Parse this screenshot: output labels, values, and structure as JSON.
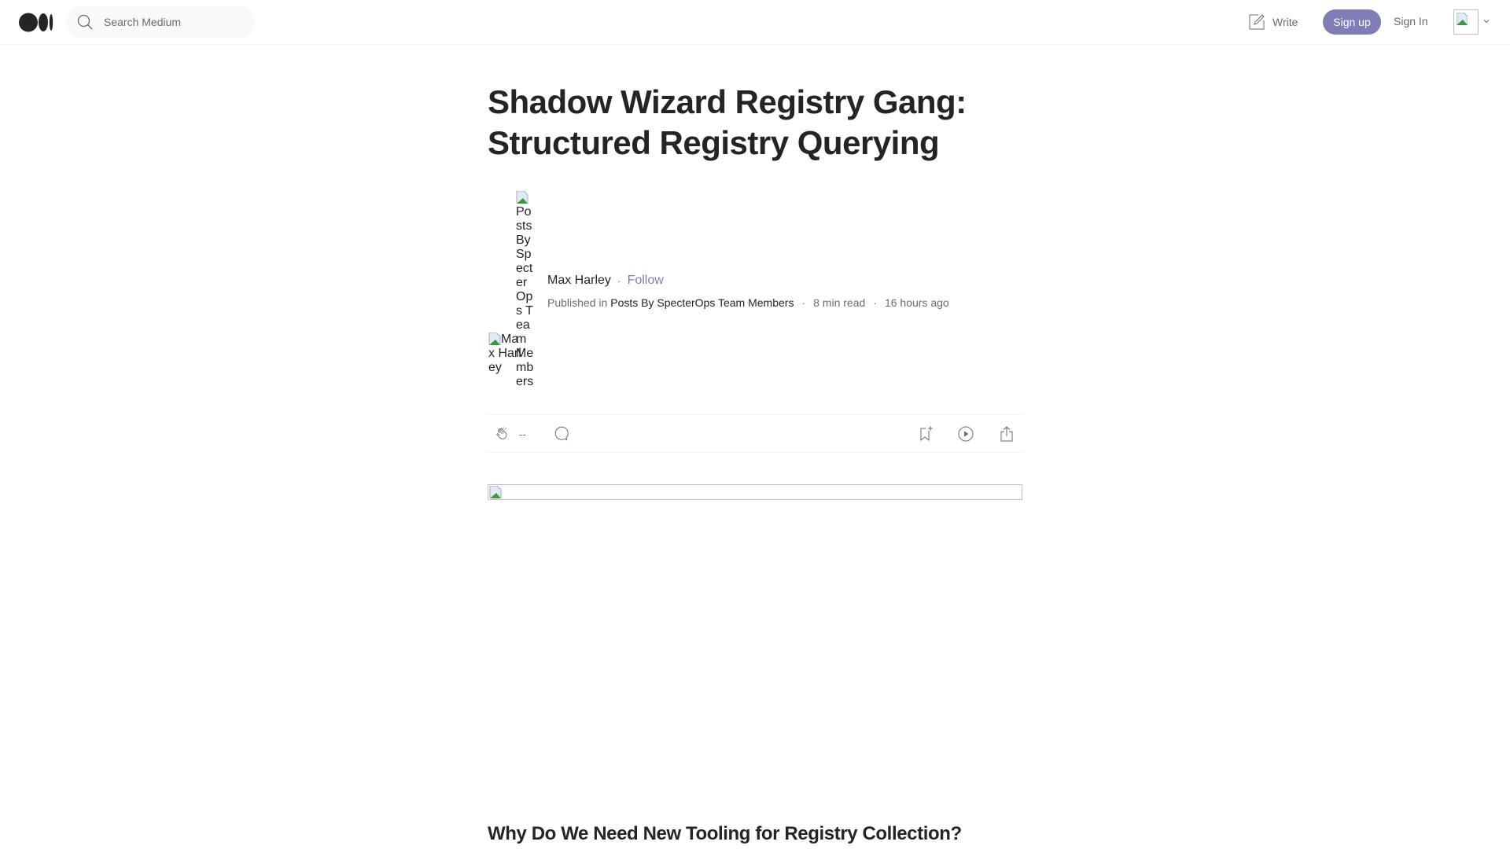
{
  "nav": {
    "logo": "medium-logo",
    "search_placeholder": "Search Medium",
    "write_label": "Write",
    "signup_label": "Sign up",
    "signin_label": "Sign In"
  },
  "article": {
    "title": "Shadow Wizard Registry Gang: Structured Registry Querying",
    "publication_avatar_alt": "Posts By SpecterOps Team Members",
    "author_avatar_alt": "Max Harley",
    "author": "Max Harley",
    "follow_label": "Follow",
    "published_in_label": "Published in",
    "publication": "Posts By SpecterOps Team Members",
    "read_time": "8 min read",
    "posted": "16 hours ago",
    "separator": "·",
    "clap_count": "--",
    "section_heading": "Why Do We Need New Tooling for Registry Collection?"
  },
  "colors": {
    "accent": "#7f7cb6",
    "text": "#242424",
    "muted": "#6b6b6b",
    "divider": "#f2f2f2"
  }
}
